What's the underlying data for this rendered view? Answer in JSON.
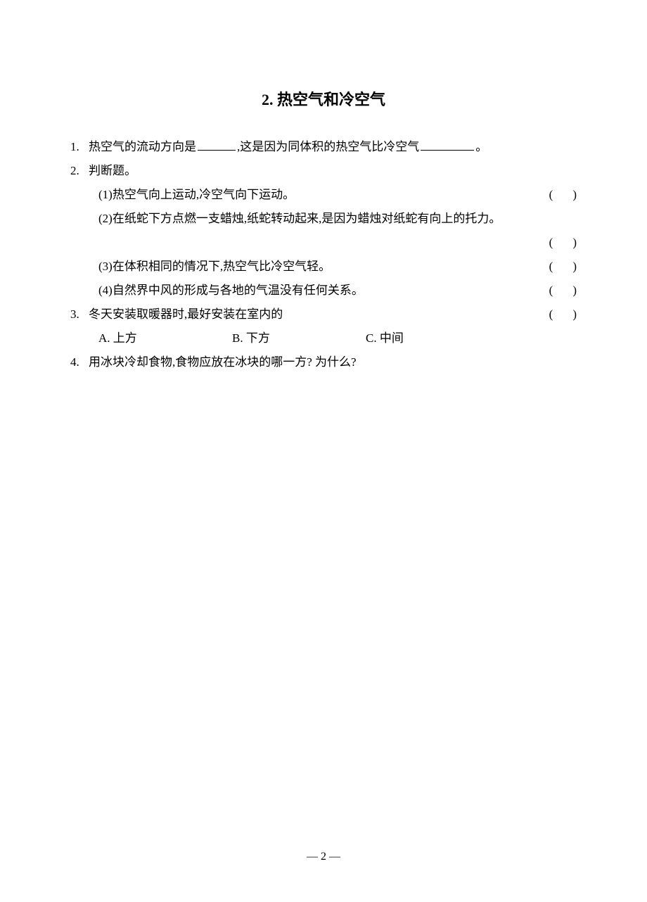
{
  "title": "2.  热空气和冷空气",
  "q1": {
    "num": "1.",
    "pre": "热空气的流动方向是",
    "mid": ",这是因为同体积的热空气比冷空气",
    "end": "。"
  },
  "q2": {
    "num": "2.",
    "label": "判断题。",
    "items": [
      "(1)热空气向上运动,冷空气向下运动。",
      "(2)在纸蛇下方点燃一支蜡烛,纸蛇转动起来,是因为蜡烛对纸蛇有向上的托力。",
      "(3)在体积相同的情况下,热空气比冷空气轻。",
      "(4)自然界中风的形成与各地的气温没有任何关系。"
    ]
  },
  "q3": {
    "num": "3.",
    "text": "冬天安装取暖器时,最好安装在室内的",
    "options": {
      "A": "A. 上方",
      "B": "B. 下方",
      "C": "C. 中间"
    }
  },
  "q4": {
    "num": "4.",
    "text": "用冰块冷却食物,食物应放在冰块的哪一方? 为什么?"
  },
  "paren": {
    "l": "(",
    "r": ")"
  },
  "page": "—  2  —"
}
